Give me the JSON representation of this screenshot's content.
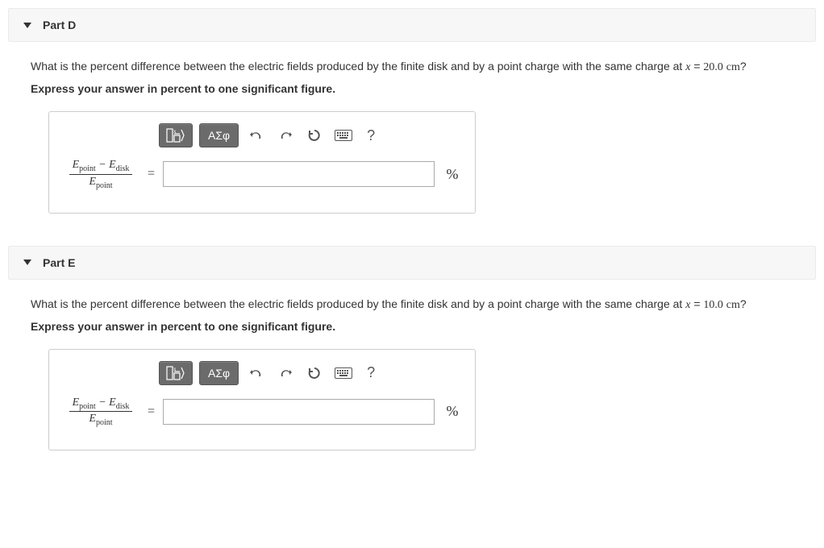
{
  "parts": [
    {
      "title": "Part D",
      "question_prefix": "What is the percent difference between the electric fields produced by the finite disk and by a point charge with the same charge at ",
      "x_var": "x",
      "x_val": "20.0",
      "x_unit": "cm",
      "question_suffix": "?",
      "instruction": "Express your answer in percent to one significant figure.",
      "formula_numerator_a": "E",
      "formula_numerator_a_sub": "point",
      "formula_minus": " − ",
      "formula_numerator_b": "E",
      "formula_numerator_b_sub": "disk",
      "formula_denom": "E",
      "formula_denom_sub": "point",
      "equals": "=",
      "unit": "%",
      "toolbar": {
        "greek": "ΑΣφ",
        "help": "?"
      }
    },
    {
      "title": "Part E",
      "question_prefix": "What is the percent difference between the electric fields produced by the finite disk and by a point charge with the same charge at ",
      "x_var": "x",
      "x_val": "10.0",
      "x_unit": "cm",
      "question_suffix": "?",
      "instruction": "Express your answer in percent to one significant figure.",
      "formula_numerator_a": "E",
      "formula_numerator_a_sub": "point",
      "formula_minus": " − ",
      "formula_numerator_b": "E",
      "formula_numerator_b_sub": "disk",
      "formula_denom": "E",
      "formula_denom_sub": "point",
      "equals": "=",
      "unit": "%",
      "toolbar": {
        "greek": "ΑΣφ",
        "help": "?"
      }
    }
  ]
}
